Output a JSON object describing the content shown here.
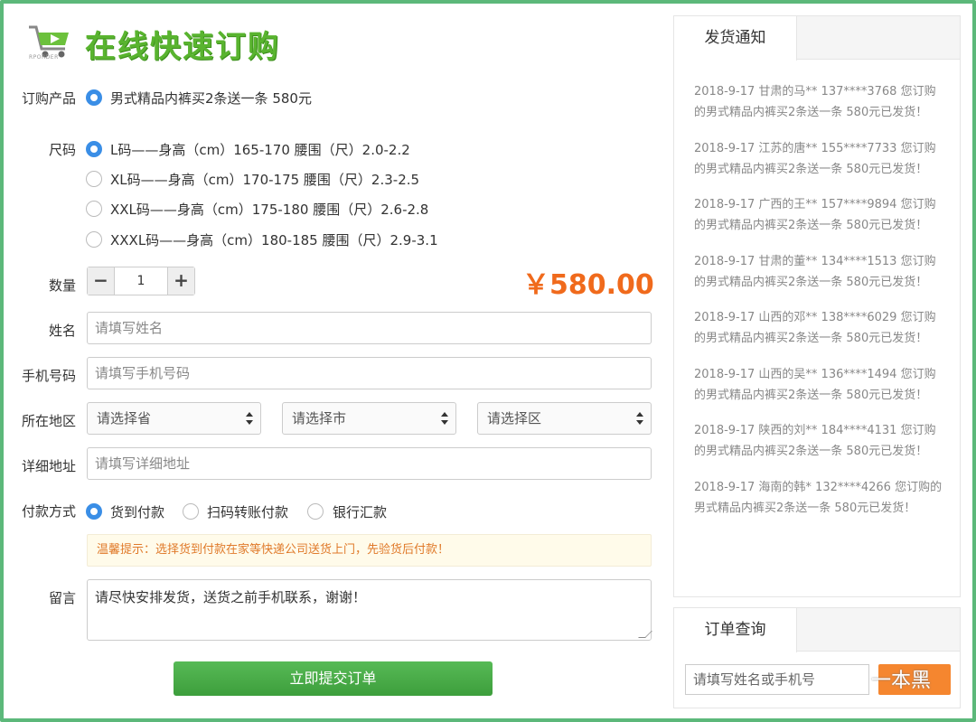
{
  "header": {
    "title": "在线快速订购",
    "logo_text": "RPORDER"
  },
  "form": {
    "product": {
      "label": "订购产品",
      "options": [
        "男式精品内裤买2条送一条 580元"
      ]
    },
    "size": {
      "label": "尺码",
      "options": [
        "L码——身高（cm）165-170 腰围（尺）2.0-2.2",
        "XL码——身高（cm）170-175 腰围（尺）2.3-2.5",
        "XXL码——身高（cm）175-180 腰围（尺）2.6-2.8",
        "XXXL码——身高（cm）180-185 腰围（尺）2.9-3.1"
      ]
    },
    "quantity": {
      "label": "数量",
      "minus": "−",
      "plus": "+",
      "value": "1"
    },
    "price": "￥580.00",
    "name": {
      "label": "姓名",
      "placeholder": "请填写姓名"
    },
    "phone": {
      "label": "手机号码",
      "placeholder": "请填写手机号码"
    },
    "region": {
      "label": "所在地区",
      "province": "请选择省",
      "city": "请选择市",
      "district": "请选择区"
    },
    "address": {
      "label": "详细地址",
      "placeholder": "请填写详细地址"
    },
    "payment": {
      "label": "付款方式",
      "options": [
        "货到付款",
        "扫码转账付款",
        "银行汇款"
      ]
    },
    "tip": "温馨提示：选择货到付款在家等快递公司送货上门，先验货后付款！",
    "message": {
      "label": "留言",
      "value": "请尽快安排发货，送货之前手机联系，谢谢！"
    },
    "submit_label": "立即提交订单"
  },
  "notice": {
    "tab": "发货通知",
    "items": [
      "2018-9-17 甘肃的马** 137****3768 您订购的男式精品内裤买2条送一条 580元已发货！",
      "2018-9-17 江苏的唐** 155****7733 您订购的男式精品内裤买2条送一条 580元已发货！",
      "2018-9-17 广西的王** 157****9894 您订购的男式精品内裤买2条送一条 580元已发货！",
      "2018-9-17 甘肃的董** 134****1513 您订购的男式精品内裤买2条送一条 580元已发货！",
      "2018-9-17 山西的邓** 138****6029 您订购的男式精品内裤买2条送一条 580元已发货！",
      "2018-9-17 山西的吴** 136****1494 您订购的男式精品内裤买2条送一条 580元已发货！",
      "2018-9-17 陕西的刘** 184****4131 您订购的男式精品内裤买2条送一条 580元已发货！",
      "2018-9-17 海南的韩* 132****4266 您订购的男式精品内裤买2条送一条 580元已发货！"
    ]
  },
  "order_query": {
    "tab": "订单查询",
    "placeholder": "请填写姓名或手机号"
  },
  "watermark": "一本黑",
  "colors": {
    "brand_green": "#59b42f",
    "frame": "#5cb87a",
    "price": "#f06a1c",
    "radio_checked": "#3a8ee6",
    "query_button": "#f5862f"
  }
}
